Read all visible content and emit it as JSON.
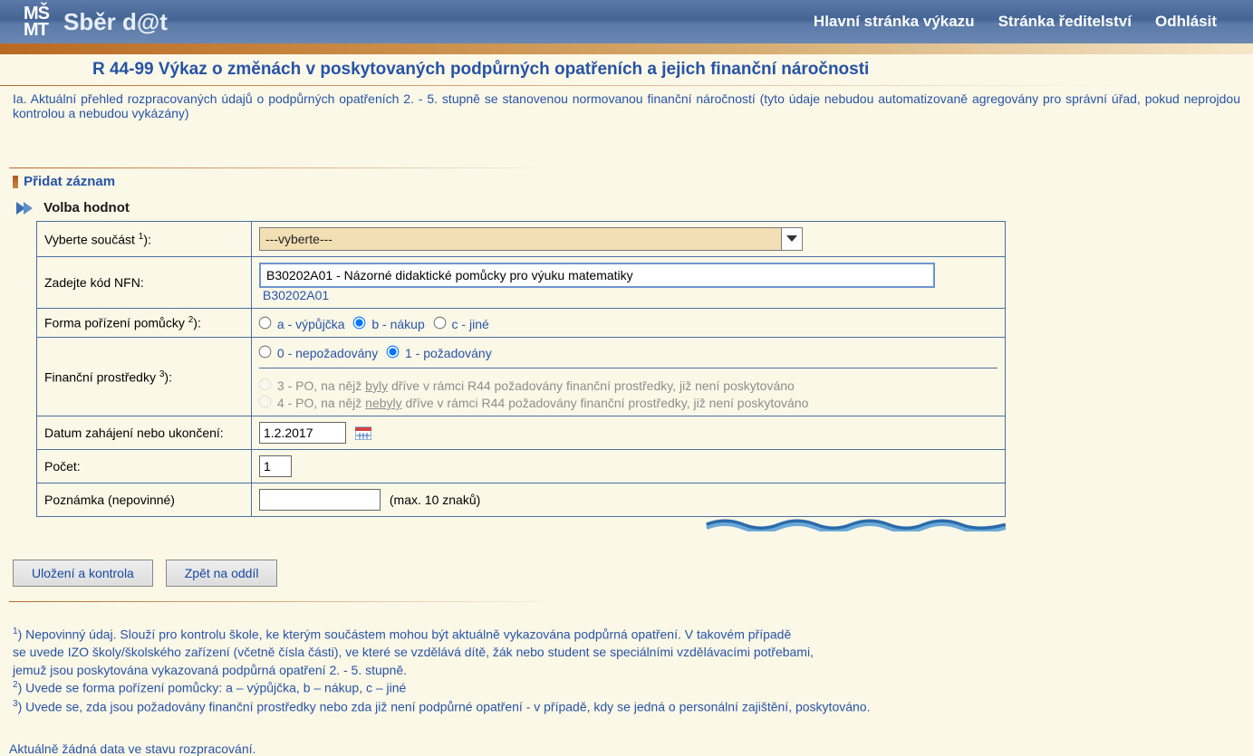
{
  "header": {
    "logo_top": "MŠ",
    "logo_bot": "MT",
    "app_name": "Sběr d@t",
    "nav": {
      "main": "Hlavní stránka výkazu",
      "director": "Stránka ředitelství",
      "logout": "Odhlásit"
    }
  },
  "page_title": "R 44-99 Výkaz o změnách v poskytovaných podpůrných opatřeních a jejich finanční náročnosti",
  "intro": "Ia. Aktuální přehled rozpracovaných údajů o podpůrných opatřeních 2. - 5. stupně se stanovenou normovanou finanční náročností (tyto údaje nebudou automatizovaně agregovány pro správní úřad, pokud neprojdou kontrolou a nebudou vykázány)",
  "section_add": "Přidat záznam",
  "section_values": "Volba hodnot",
  "form": {
    "row_part": "Vyberte součást ",
    "part_sup": "1",
    "part_selected": "---vyberte---",
    "row_code": "Zadejte kód NFN:",
    "code_value": "B30202A01 - Názorné didaktické pomůcky pro výuku matematiky",
    "code_short": "B30202A01",
    "row_form": "Forma pořízení pomůcky ",
    "form_sup": "2",
    "form_a": "a - výpůjčka",
    "form_b": "b - nákup",
    "form_c": "c - jiné",
    "row_fin": "Finanční prostředky ",
    "fin_sup": "3",
    "fin_0": "0 - nepožadovány",
    "fin_1": "1 - požadovány",
    "fin_3_pre": "3 - PO, na nějž ",
    "fin_3_u": "byly",
    "fin_3_post": " dříve v rámci R44 požadovány finanční prostředky, již není poskytováno",
    "fin_4_pre": "4 - PO, na nějž ",
    "fin_4_u": "nebyly",
    "fin_4_post": " dříve v rámci R44 požadovány finanční prostředky, již není poskytováno",
    "row_date": "Datum zahájení nebo ukončení:",
    "date_value": "1.2.2017",
    "row_count": "Počet:",
    "count_value": "1",
    "row_note": "Poznámka (nepovinné)",
    "note_value": "",
    "note_hint": "(max. 10 znaků)"
  },
  "buttons": {
    "save": "Uložení a kontrola",
    "back": "Zpět na oddíl"
  },
  "footnotes": {
    "f1": ") Nepovinný údaj. Slouží pro kontrolu škole, ke kterým součástem mohou být aktuálně vykazována podpůrná opatření. V takovém případě",
    "f1b": "se uvede IZO školy/školského zařízení (včetně čísla části), ve které se vzdělává dítě, žák nebo student se speciálními vzdělávacími potřebami,",
    "f1c": "jemuž jsou poskytována vykazovaná podpůrná opatření 2. - 5. stupně.",
    "f2": ") Uvede se forma pořízení pomůcky: a – výpůjčka, b – nákup, c – jiné",
    "f3": ") Uvede se, zda jsou požadovány finanční prostředky nebo zda již není podpůrné opatření - v případě, kdy se jedná o personální zajištění, poskytováno."
  },
  "no_data": "Aktuálně žádná data ve stavu rozpracování."
}
